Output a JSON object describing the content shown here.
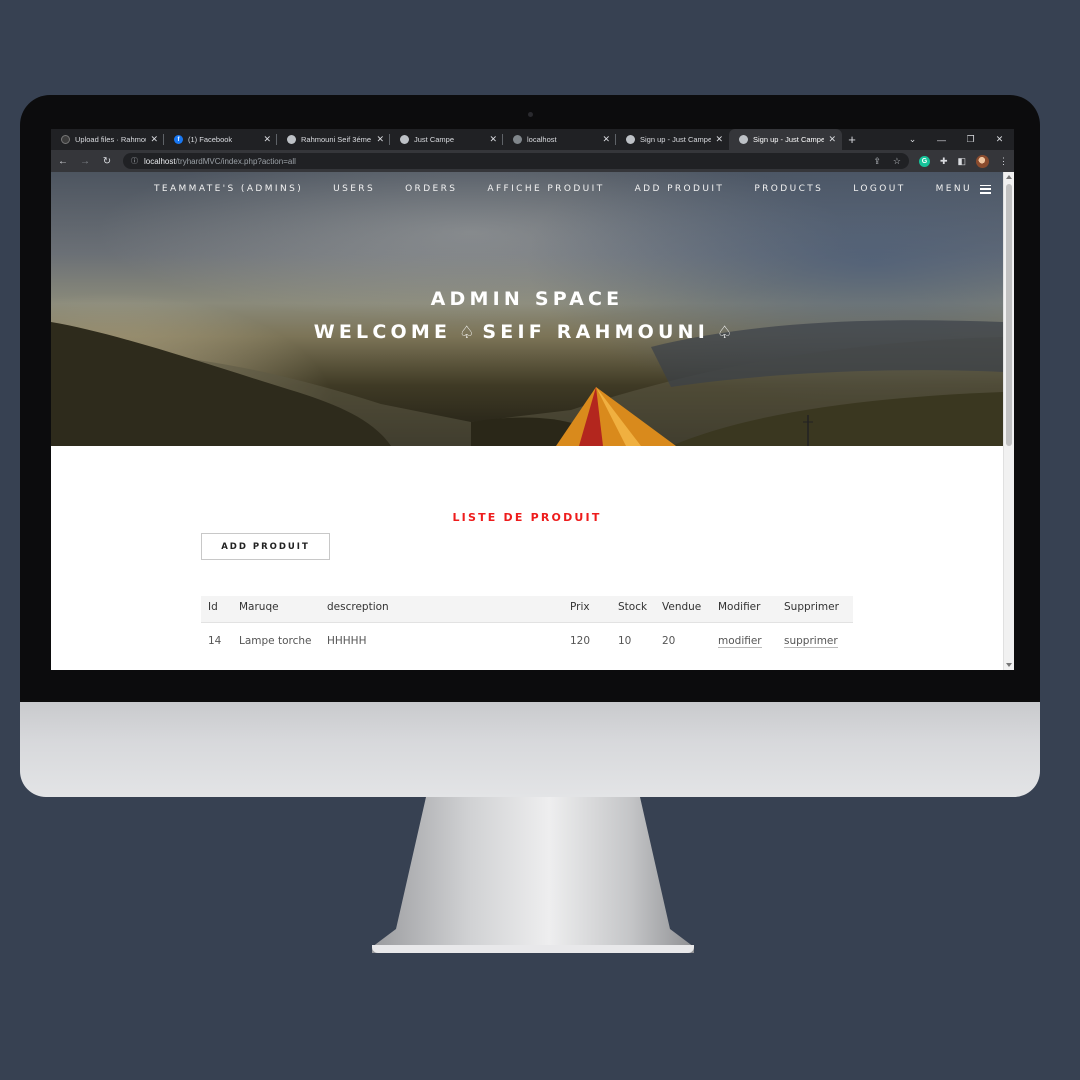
{
  "browser": {
    "tabs": [
      {
        "title": "Upload files · Rahmou",
        "icon": "github-icon",
        "active": false
      },
      {
        "title": "(1) Facebook",
        "icon": "facebook-icon",
        "active": false
      },
      {
        "title": "Rahmouni Seif 3éme",
        "icon": "globe-icon",
        "active": false
      },
      {
        "title": "Just Campe",
        "icon": "globe-icon",
        "active": false
      },
      {
        "title": "localhost",
        "icon": "globe-icon",
        "active": false
      },
      {
        "title": "Sign up - Just Campe",
        "icon": "globe-icon",
        "active": false
      },
      {
        "title": "Sign up - Just Campe",
        "icon": "globe-icon",
        "active": true
      }
    ],
    "url_host": "localhost",
    "url_path": "/tryhardMVC/index.php?action=all"
  },
  "nav": {
    "items": [
      "TEAMMATE'S (ADMINS)",
      "USERS",
      "ORDERS",
      "AFFICHE PRODUIT",
      "ADD PRODUIT",
      "PRODUCTS",
      "LOGOUT"
    ],
    "menu_label": "MENU"
  },
  "hero": {
    "title": "ADMIN SPACE",
    "welcome": "WELCOME",
    "user": "SEIF RAHMOUNI"
  },
  "main": {
    "section_title": "LISTE DE PRODUIT",
    "add_button": "ADD PRODUIT",
    "columns": [
      "Id",
      "Maruqe",
      "descreption",
      "Prix",
      "Stock",
      "Vendue",
      "Modifier",
      "Supprimer"
    ],
    "rows": [
      {
        "id": "14",
        "marque": "Lampe torche",
        "description": "HHHHH",
        "prix": "120",
        "stock": "10",
        "vendue": "20",
        "modifier": "modifier",
        "supprimer": "supprimer"
      }
    ]
  },
  "colors": {
    "background": "#374152",
    "accent_red": "#ee1c1c",
    "browser_dark": "#202124"
  }
}
